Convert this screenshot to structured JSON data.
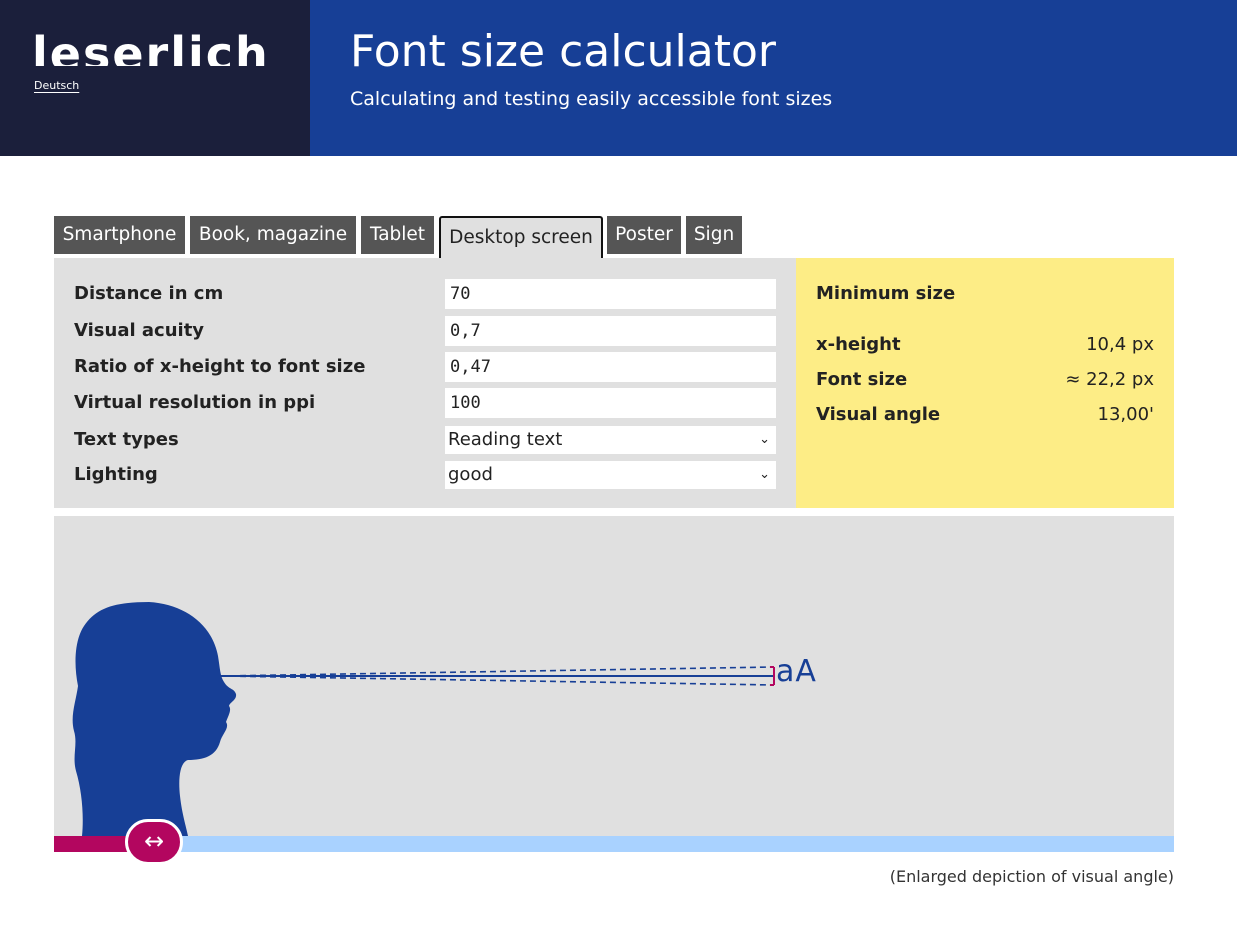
{
  "header": {
    "logo": "leserlich",
    "language_link": "Deutsch",
    "title": "Font size calculator",
    "subtitle": "Calculating and testing easily accessible font sizes"
  },
  "tabs": [
    {
      "label": "Smartphone",
      "active": false
    },
    {
      "label": "Book, magazine",
      "active": false
    },
    {
      "label": "Tablet",
      "active": false
    },
    {
      "label": "Desktop screen",
      "active": true
    },
    {
      "label": "Poster",
      "active": false
    },
    {
      "label": "Sign",
      "active": false
    }
  ],
  "form": {
    "distance": {
      "label": "Distance in cm",
      "value": "70"
    },
    "acuity": {
      "label": "Visual acuity",
      "value": "0,7"
    },
    "ratio": {
      "label": "Ratio of x-height to font size",
      "value": "0,47"
    },
    "resolution": {
      "label": "Virtual resolution in ppi",
      "value": "100"
    },
    "text_types": {
      "label": "Text types",
      "value": "Reading text"
    },
    "lighting": {
      "label": "Lighting",
      "value": "good"
    }
  },
  "result": {
    "heading": "Minimum size",
    "x_height": {
      "label": "x-height",
      "value": "10,4 px"
    },
    "font_size": {
      "label": "Font size",
      "value": "≈ 22,2 px"
    },
    "visual_angle": {
      "label": "Visual angle",
      "value": "13,00'"
    }
  },
  "illustration": {
    "sample_text": "aA",
    "slider_icon": "↔",
    "caption": "(Enlarged depiction of visual angle)"
  },
  "colors": {
    "header_blue": "#173f96",
    "logo_navy": "#1b1f3b",
    "result_yellow": "#fded86",
    "accent_magenta": "#b3065f",
    "track_blue": "#a9d2ff"
  }
}
